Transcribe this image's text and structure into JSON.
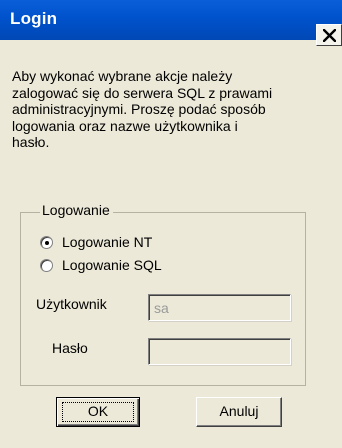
{
  "window": {
    "title": "Login",
    "close_glyph": "×"
  },
  "description": "Aby wykonać wybrane akcje należy\nzalogować się do serwera SQL z prawami\nadministracyjnymi. Proszę podać sposób\nlogowania oraz nazwe użytkownika i\nhasło.",
  "group": {
    "label": "Logowanie",
    "options": [
      {
        "label": "Logowanie NT",
        "selected": true
      },
      {
        "label": "Logowanie SQL",
        "selected": false
      }
    ],
    "fields": {
      "user_label": "Użytkownik",
      "user_value": "sa",
      "password_label": "Hasło",
      "password_value": ""
    }
  },
  "buttons": {
    "ok": "OK",
    "cancel": "Anuluj"
  },
  "colors": {
    "titlebar": "#0052cc",
    "dialog_bg": "#ece9d8"
  }
}
